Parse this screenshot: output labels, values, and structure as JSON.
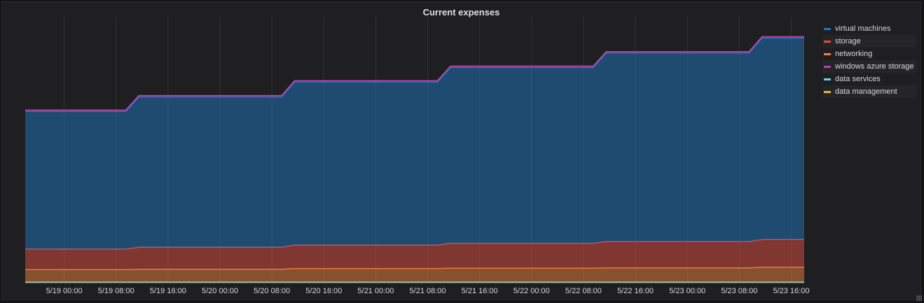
{
  "chart_data": {
    "type": "area",
    "stacked": true,
    "title": "Current expenses",
    "xlabel": "",
    "ylabel": "",
    "grid": true,
    "legend_position": "right",
    "x_ticks": [
      "5/19 00:00",
      "5/19 08:00",
      "5/19 16:00",
      "5/20 00:00",
      "5/20 08:00",
      "5/20 16:00",
      "5/21 00:00",
      "5/21 08:00",
      "5/21 16:00",
      "5/22 00:00",
      "5/22 08:00",
      "5/22 16:00",
      "5/23 00:00",
      "5/23 08:00",
      "5/23 16:00"
    ],
    "x": [
      "5/18 18:00",
      "5/19 09:30",
      "5/19 11:30",
      "5/20 09:30",
      "5/20 11:30",
      "5/21 09:30",
      "5/21 11:30",
      "5/22 09:30",
      "5/22 11:30",
      "5/23 09:30",
      "5/23 11:30",
      "5/23 18:00"
    ],
    "series": [
      {
        "name": "data management",
        "color": "#eab839",
        "values": [
          0.5,
          0.5,
          0.5,
          0.5,
          0.5,
          0.5,
          0.5,
          0.5,
          0.5,
          0.5,
          0.5,
          0.5
        ]
      },
      {
        "name": "data services",
        "color": "#6ed0e0",
        "values": [
          0.5,
          0.5,
          0.5,
          0.5,
          0.5,
          0.5,
          0.5,
          0.5,
          0.5,
          0.5,
          0.5,
          0.5
        ]
      },
      {
        "name": "networking",
        "color": "#ef843c",
        "values": [
          17.5,
          17.5,
          18,
          18,
          19,
          19,
          19.5,
          19.5,
          20,
          20,
          21,
          21
        ]
      },
      {
        "name": "storage",
        "color": "#e24d42",
        "values": [
          29,
          29,
          31,
          31,
          33,
          33,
          35,
          35,
          37,
          37,
          39,
          39
        ]
      },
      {
        "name": "virtual machines",
        "color": "#1f78c1",
        "values": [
          194,
          194,
          212,
          212,
          230,
          230,
          248,
          248,
          266,
          266,
          284,
          284
        ]
      },
      {
        "name": "windows azure storage",
        "color": "#ba43a9",
        "values": [
          2,
          2,
          2,
          2,
          2,
          2,
          2,
          2,
          2,
          2,
          2,
          2
        ]
      }
    ],
    "legend": [
      {
        "name": "virtual machines",
        "color": "#1f78c1"
      },
      {
        "name": "storage",
        "color": "#e24d42"
      },
      {
        "name": "networking",
        "color": "#ef843c"
      },
      {
        "name": "windows azure storage",
        "color": "#ba43a9"
      },
      {
        "name": "data services",
        "color": "#6ed0e0"
      },
      {
        "name": "data management",
        "color": "#eab839"
      }
    ],
    "ylim": [
      0,
      375
    ]
  }
}
